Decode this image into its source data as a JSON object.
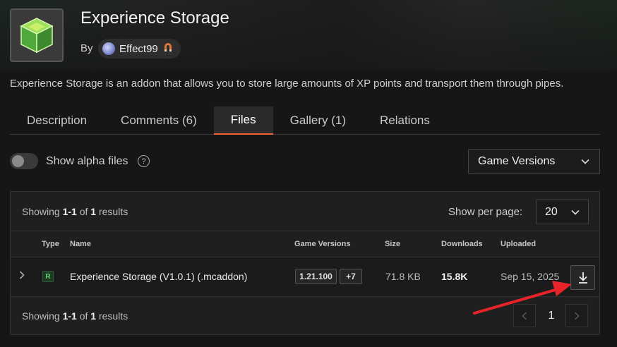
{
  "project": {
    "title": "Experience Storage",
    "by_label": "By",
    "author": "Effect99",
    "summary": "Experience Storage is an addon that allows you to store large amounts of XP points and transport them through pipes."
  },
  "tabs": [
    {
      "label": "Description",
      "active": false
    },
    {
      "label": "Comments (6)",
      "active": false
    },
    {
      "label": "Files",
      "active": true
    },
    {
      "label": "Gallery (1)",
      "active": false
    },
    {
      "label": "Relations",
      "active": false
    }
  ],
  "filters": {
    "alpha_label": "Show alpha files",
    "alpha_enabled": false,
    "help_glyph": "?",
    "game_versions_label": "Game Versions"
  },
  "results": {
    "showing_prefix": "Showing",
    "range": "1-1",
    "of_word": "of",
    "count": "1",
    "results_word": "results",
    "per_page_label": "Show per page:",
    "per_page_value": "20"
  },
  "table": {
    "headers": {
      "type": "Type",
      "name": "Name",
      "game_versions": "Game Versions",
      "size": "Size",
      "downloads": "Downloads",
      "uploaded": "Uploaded"
    },
    "rows": [
      {
        "type": "R",
        "name": "Experience Storage (V1.0.1) (.mcaddon)",
        "game_version": "1.21.100",
        "more_versions": "+7",
        "size": "71.8 KB",
        "downloads": "15.8K",
        "uploaded": "Sep 15, 2025"
      }
    ]
  },
  "pagination": {
    "current_page": "1"
  },
  "colors": {
    "accent": "#f16436",
    "annotation_arrow": "#e8242a",
    "release_badge": "#5fd37a"
  },
  "icons": [
    "chevron-down-icon",
    "chevron-right-icon",
    "chevron-left-icon",
    "download-icon",
    "help-icon",
    "magnet-icon"
  ]
}
